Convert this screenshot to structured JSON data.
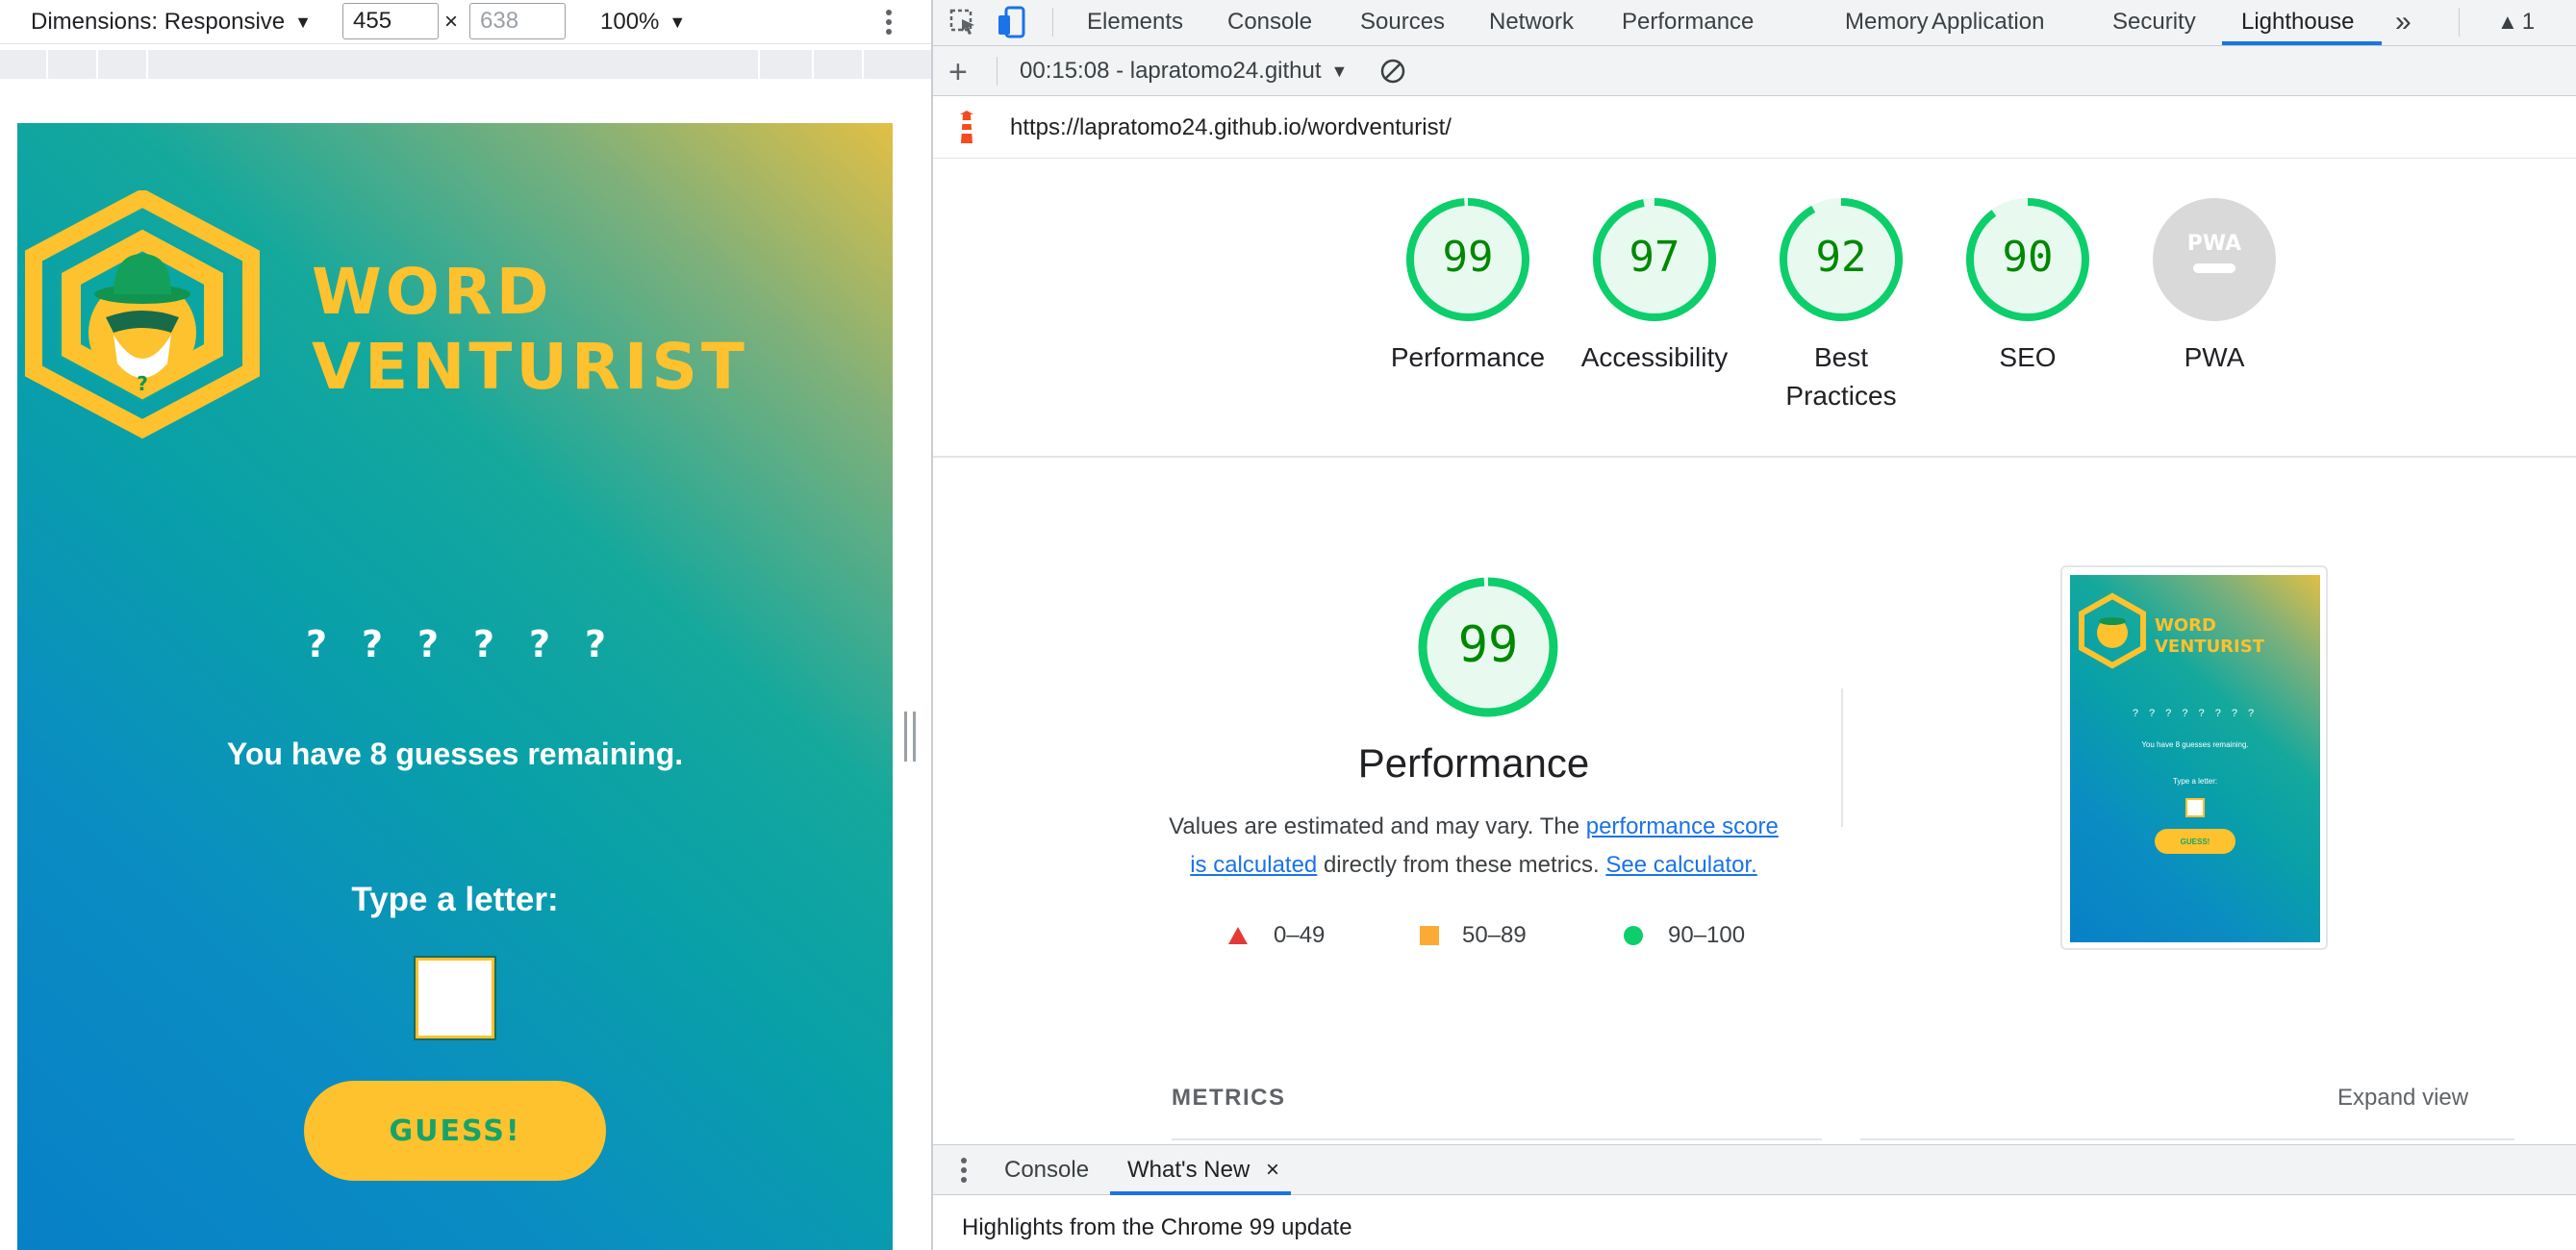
{
  "device_toolbar": {
    "dimensions_label": "Dimensions: Responsive",
    "width_value": "455",
    "times_symbol": "×",
    "height_placeholder": "638",
    "zoom": "100%"
  },
  "page": {
    "title_word1": "WORD",
    "title_word2": "VENTURIST",
    "hint_symbol": "?",
    "word_placeholder": [
      "?",
      "?",
      "?",
      "?",
      "?",
      "?"
    ],
    "guesses_message": "You have 8 guesses remaining.",
    "input_label": "Type a letter:",
    "guess_button": "GUESS!"
  },
  "devtools": {
    "tabs": [
      "Elements",
      "Console",
      "Sources",
      "Network",
      "Performance",
      "Memory",
      "Application",
      "Security",
      "Lighthouse"
    ],
    "active_tab": "Lighthouse",
    "more_tabs": "»",
    "warning_count": "1",
    "report_selector": "00:15:08 - lapratomo24.githut",
    "url": "https://lapratomo24.github.io/wordventurist/"
  },
  "scores": [
    {
      "label": "Performance",
      "value": "99",
      "fraction": 0.99
    },
    {
      "label": "Accessibility",
      "value": "97",
      "fraction": 0.97
    },
    {
      "label": "Best Practices",
      "value": "92",
      "fraction": 0.92
    },
    {
      "label": "SEO",
      "value": "90",
      "fraction": 0.9
    },
    {
      "label": "PWA",
      "value": "",
      "fraction": 0
    }
  ],
  "pwa_badge_text": "PWA",
  "performance_section": {
    "score": "99",
    "score_fraction": 0.99,
    "title": "Performance",
    "desc_prefix": "Values are estimated and may vary. The ",
    "desc_link1": "performance score is calculated",
    "desc_middle": " directly from these metrics. ",
    "desc_link2": "See calculator.",
    "legend": [
      {
        "range": "0–49",
        "color": "#e53935"
      },
      {
        "range": "50–89",
        "color": "#fbaa36"
      },
      {
        "range": "90–100",
        "color": "#0cce6b"
      }
    ],
    "metrics_label": "METRICS",
    "expand_view": "Expand view"
  },
  "thumbnail": {
    "title1": "WORD",
    "title2": "VENTURIST",
    "placeholders": "? ? ? ? ? ? ? ?",
    "guesses": "You have 8 guesses remaining.",
    "type_label": "Type a letter:",
    "button": "GUESS!"
  },
  "drawer": {
    "tabs": [
      "Console",
      "What's New"
    ],
    "active": "What's New",
    "close_symbol": "×",
    "highlights": "Highlights from the Chrome 99 update"
  },
  "colors": {
    "pass_green": "#0cce6b",
    "score_text_green": "#008800",
    "brand_yellow": "#fdc22d",
    "link_blue": "#1a73e8"
  }
}
